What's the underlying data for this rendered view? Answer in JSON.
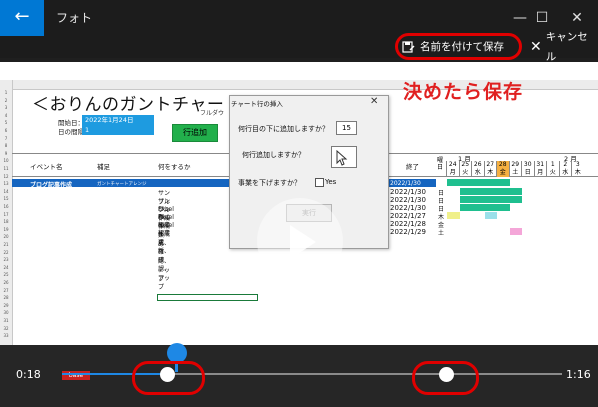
{
  "app": {
    "back_symbol": "←",
    "title": "フォト",
    "minimize": "—",
    "maximize": "☐",
    "close": "✕"
  },
  "toolbar": {
    "save_as_label": "名前を付けて保存",
    "cancel_label": "キャンセル"
  },
  "annotation": {
    "text": "決めたら保存",
    "color": "#e02020"
  },
  "spreadsheet": {
    "title": "＜おりんのガントチャート＞",
    "start_date_label": "開始日：",
    "start_date_value": "2022年1月24日",
    "period_label": "日の間隔：",
    "period_value": "1",
    "add_row_button": "行追加",
    "full_text": "フルダウ",
    "headers": {
      "event": "イベント名",
      "note": "補足",
      "what": "何をするか",
      "end": "終了",
      "weekday": "曜日"
    },
    "month1": "1 月",
    "month2": "2 月",
    "days": [
      "24",
      "25",
      "26",
      "27",
      "28",
      "29",
      "30",
      "31",
      "1",
      "2",
      "3"
    ],
    "weekdays": [
      "月",
      "火",
      "水",
      "木",
      "金",
      "土",
      "日",
      "月",
      "火",
      "水",
      "木"
    ],
    "row10": {
      "event": "ブログ記事作成",
      "note": "ガントチャートアレンジ",
      "end": "2022/1/30"
    },
    "rows": [
      {
        "what": "サンプルExcel作成",
        "end": "2022/1/30",
        "wd": "日"
      },
      {
        "what": "サンプルExcel作成",
        "end": "2022/1/30",
        "wd": "日"
      },
      {
        "what": "サンプルExcel作成",
        "end": "2022/1/30",
        "wd": "日"
      },
      {
        "what": "画像集め",
        "end": "2022/1/27",
        "wd": "木"
      },
      {
        "what": "記事作成、確認、アップ",
        "end": "2022/1/28",
        "wd": "金"
      },
      {
        "what": "記事更新、確認、アップ",
        "end": "2022/1/29",
        "wd": "土"
      }
    ],
    "row_numbers": [
      "1",
      "2",
      "3",
      "4",
      "5",
      "6",
      "7",
      "8",
      "9",
      "10",
      "11",
      "12",
      "13",
      "14",
      "15",
      "16",
      "17",
      "18",
      "19",
      "20",
      "21",
      "22",
      "23",
      "24",
      "25",
      "26",
      "27",
      "28",
      "29",
      "30",
      "31",
      "32",
      "33"
    ]
  },
  "dialog": {
    "title": "チャート行の挿入",
    "close": "✕",
    "q1": "何行目の下に追加しますか？",
    "q1_value": "15",
    "q2": "何行追加しますか？",
    "q3": "事業を下げますか？",
    "checkbox_label": "Yes",
    "execute_button": "実行"
  },
  "video": {
    "current_time": "0:18",
    "total_time": "1:16",
    "sheet_tab": "base",
    "accent": "#1e88e5"
  }
}
